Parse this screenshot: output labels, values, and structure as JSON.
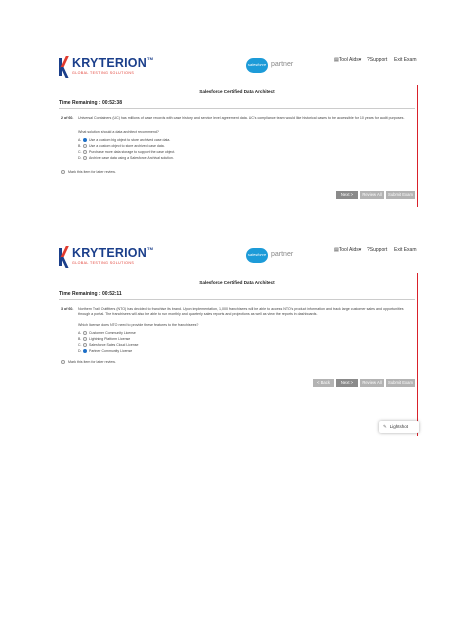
{
  "brand": {
    "logo_text": "KRYTERION",
    "logo_tm": "TM",
    "logo_sub": "GLOBAL TESTING SOLUTIONS",
    "salesforce_cloud": "salesforce",
    "partner": "partner"
  },
  "nav": {
    "tool_aids": "Tool Aids",
    "support": "Support",
    "exit": "Exit Exam"
  },
  "exam_title": "Salesforce Certified Data Architect",
  "screens": [
    {
      "time": "Time Remaining : 00:52:38",
      "qnum": "2 of 60.",
      "question": "Universal Containers (UC) has millions of case records with case history and service level agreement data. UC's compliance team would like historical cases to be accessible for 10 years for audit purposes.",
      "prompt": "What solution should a data architect recommend?",
      "options": [
        {
          "letter": "A.",
          "text": "Use a custom big object to store archived case data.",
          "selected": true
        },
        {
          "letter": "B.",
          "text": "Use a custom object to store archived case data.",
          "selected": false
        },
        {
          "letter": "C.",
          "text": "Purchase more data storage to support the case object.",
          "selected": false
        },
        {
          "letter": "D.",
          "text": "Archive case data using a Salesforce Archival solution.",
          "selected": false
        }
      ],
      "mark_label": "Mark this item for later review.",
      "buttons": {
        "next": "Next >",
        "review_all": "Review All",
        "submit": "Submit Exam"
      }
    },
    {
      "time": "Time Remaining : 00:52:11",
      "qnum": "3 of 60.",
      "question": "Northern Trail Outfitters (NTO) has decided to franchise its brand. Upon implementation, 1,000 franchisees will be able to access NTO's product information and track large customer sales and opportunities through a portal. The franchisees will also be able to run monthly and quarterly sales reports and projections as well as view the reports in dashboards.",
      "prompt": "Which license does NTO need to provide these features to the franchisees?",
      "options": [
        {
          "letter": "A.",
          "text": "Customer Community License",
          "selected": false
        },
        {
          "letter": "B.",
          "text": "Lightning Platform License",
          "selected": false
        },
        {
          "letter": "C.",
          "text": "Salesforce Sales Cloud License",
          "selected": false
        },
        {
          "letter": "D.",
          "text": "Partner Community License",
          "selected": true
        }
      ],
      "mark_label": "Mark this item for later review.",
      "buttons": {
        "back": "< Back",
        "next": "Next >",
        "review_all": "Review All",
        "submit": "Submit Exam"
      }
    }
  ],
  "lightning_label": "Lightshot",
  "colors": {
    "brand_blue": "#1b3f8b",
    "brand_red": "#e03a2f",
    "salesforce_blue": "#1d9bd8",
    "button_gray": "#b3b3b3",
    "button_active": "#8a8a8a",
    "radio_selected": "#1d6fc7",
    "border_red": "#d9212a"
  }
}
